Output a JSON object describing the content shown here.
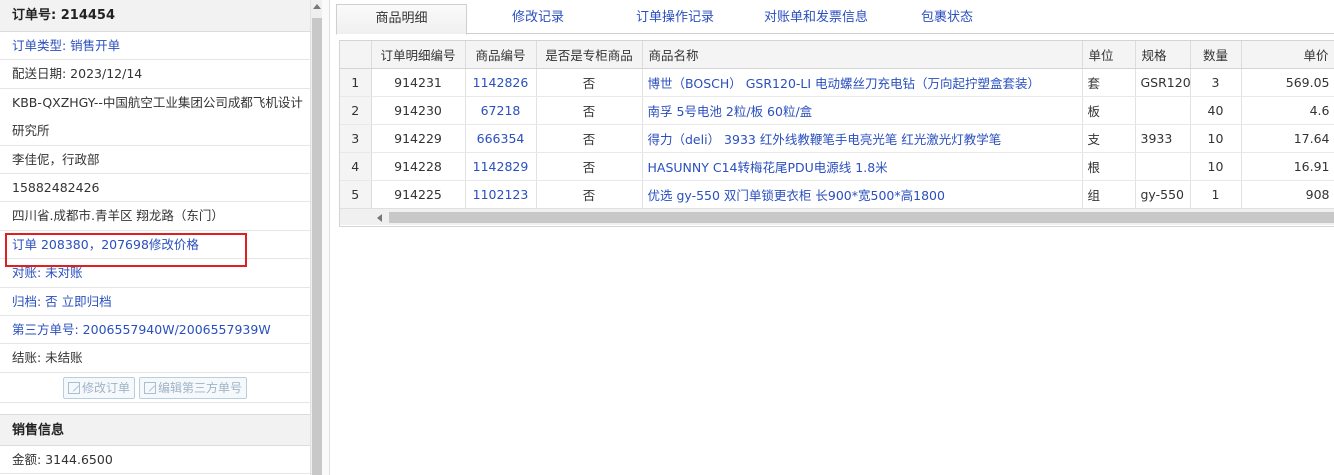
{
  "order": {
    "title": "订单号: 214454",
    "type": "订单类型: 销售开单",
    "delivery_date": "配送日期: 2023/12/14",
    "customer": "KBB-QXZHGY--中国航空工业集团公司成都飞机设计研究所",
    "contact": "李佳伲，行政部",
    "phone": "15882482426",
    "address": "四川省.成都市.青羊区 翔龙路（东门）",
    "remark": "订单 208380，207698修改价格",
    "reconcile": "对账: 未对账",
    "archive": "归档:  否 立即归档",
    "third_party": "第三方单号: 2006557940W/2006557939W",
    "settle": "结账: 未结账",
    "edit_order_label": "修改订单",
    "edit_third_label": "编辑第三方单号"
  },
  "sales": {
    "section_title": "销售信息",
    "amount": "金额: 3144.6500"
  },
  "tabs": [
    {
      "label": "商品明细"
    },
    {
      "label": "修改记录"
    },
    {
      "label": "订单操作记录"
    },
    {
      "label": "对账单和发票信息"
    },
    {
      "label": "包裹状态"
    }
  ],
  "table": {
    "headers": [
      "",
      "订单明细编号",
      "商品编号",
      "是否是专柜商品",
      "商品名称",
      "单位",
      "规格",
      "数量",
      "单价"
    ],
    "rows": [
      {
        "n": "1",
        "detail_id": "914231",
        "sku": "1142826",
        "counter": "否",
        "name": "博世（BOSCH） GSR120-LI 电动螺丝刀充电钻（万向起拧塑盒套装）",
        "unit": "套",
        "spec": "GSR120",
        "qty": "3",
        "price": "569.05"
      },
      {
        "n": "2",
        "detail_id": "914230",
        "sku": "67218",
        "counter": "否",
        "name": "南孚 5号电池 2粒/板 60粒/盒",
        "unit": "板",
        "spec": "",
        "qty": "40",
        "price": "4.6"
      },
      {
        "n": "3",
        "detail_id": "914229",
        "sku": "666354",
        "counter": "否",
        "name": "得力（deli） 3933 红外线教鞭笔手电亮光笔 红光激光灯教学笔",
        "unit": "支",
        "spec": "3933",
        "qty": "10",
        "price": "17.64"
      },
      {
        "n": "4",
        "detail_id": "914228",
        "sku": "1142829",
        "counter": "否",
        "name": "HASUNNY C14转梅花尾PDU电源线 1.8米",
        "unit": "根",
        "spec": "",
        "qty": "10",
        "price": "16.91"
      },
      {
        "n": "5",
        "detail_id": "914225",
        "sku": "1102123",
        "counter": "否",
        "name": "优选 gy-550 双门单锁更衣柜 长900*宽500*高1800",
        "unit": "组",
        "spec": "gy-550",
        "qty": "1",
        "price": "908"
      }
    ]
  }
}
